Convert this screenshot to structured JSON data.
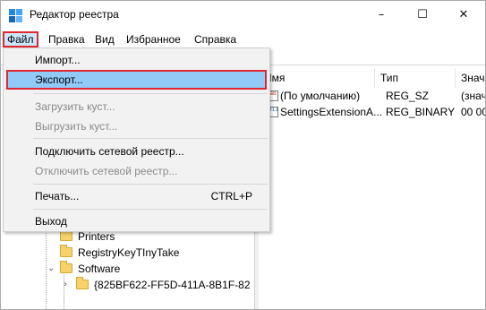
{
  "window": {
    "title": "Редактор реестра",
    "controls": {
      "minimize": "–",
      "maximize": "☐",
      "close": "✕"
    }
  },
  "menubar": {
    "items": [
      "Файл",
      "Правка",
      "Вид",
      "Избранное",
      "Справка"
    ]
  },
  "file_menu": {
    "items": [
      {
        "label": "Импорт...",
        "enabled": true
      },
      {
        "label": "Экспорт...",
        "enabled": true,
        "highlighted": true
      },
      {
        "label": "Загрузить куст...",
        "enabled": false
      },
      {
        "label": "Выгрузить куст...",
        "enabled": false
      },
      {
        "label": "Подключить сетевой реестр...",
        "enabled": true
      },
      {
        "label": "Отключить сетевой реестр...",
        "enabled": false
      },
      {
        "label": "Печать...",
        "enabled": true,
        "shortcut": "CTRL+P"
      },
      {
        "label": "Выход",
        "enabled": true
      }
    ]
  },
  "tree": {
    "items": [
      {
        "label": "Printers"
      },
      {
        "label": "RegistryKeyTInyTake"
      },
      {
        "label": "Software"
      },
      {
        "label": "{825BF622-FF5D-411A-8B1F-82"
      }
    ]
  },
  "list": {
    "columns": [
      "Имя",
      "Тип",
      "Значе"
    ],
    "rows": [
      {
        "name": "(По умолчанию)",
        "type": "REG_SZ",
        "value": "(знач"
      },
      {
        "name": "SettingsExtensionA...",
        "type": "REG_BINARY",
        "value": "00 00"
      }
    ]
  },
  "colors": {
    "highlight_border": "#e0262f",
    "highlight_fill": "#91c9f7",
    "menu_bg": "#f2f2f2"
  }
}
